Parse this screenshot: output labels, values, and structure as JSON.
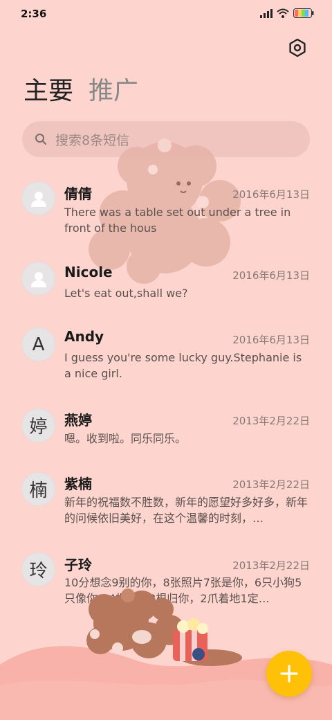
{
  "status": {
    "time": "2:36"
  },
  "tabs": [
    {
      "label": "主要"
    },
    {
      "label": "推广"
    }
  ],
  "search": {
    "placeholder": "搜索8条短信"
  },
  "conversations": [
    {
      "name": "倩倩",
      "date": "2016年6月13日",
      "preview": "There was a table set out under a tree in front of the hous",
      "avatar": "person-icon"
    },
    {
      "name": "Nicole",
      "date": "2016年6月13日",
      "preview": "Let's eat out,shall we?",
      "avatar": "person-icon"
    },
    {
      "name": "Andy",
      "date": "2016年6月13日",
      "preview": "I guess you're some lucky guy.Stephanie is a nice girl.",
      "avatar_text": "A"
    },
    {
      "name": "燕婷",
      "date": "2013年2月22日",
      "preview": "嗯。收到啦。同乐同乐。",
      "avatar_text": "婷"
    },
    {
      "name": "紫楠",
      "date": "2013年2月22日",
      "preview": "新年的祝福数不胜数，新年的愿望好多好多，新年的问候依旧美好，在这个温馨的时刻，…",
      "avatar_text": "楠"
    },
    {
      "name": "子玲",
      "date": "2013年2月22日",
      "preview": "10分想念9别的你，8张照片7张是你，6只小狗5只像你，4根骨头3根归你，2爪着地1定…",
      "avatar_text": "玲"
    }
  ],
  "colors": {
    "background": "#FDD5CE",
    "fab": "#FFC107",
    "search_bg": "#F1C5BF"
  }
}
